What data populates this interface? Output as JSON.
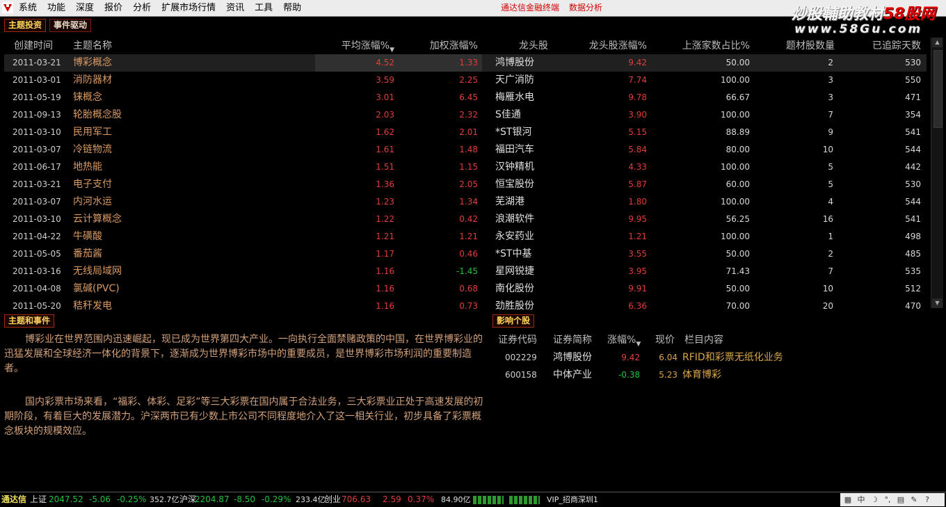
{
  "menu": {
    "items": [
      "系统",
      "功能",
      "深度",
      "报价",
      "分析",
      "扩展市场行情",
      "资讯",
      "工具",
      "帮助"
    ],
    "center_titles": [
      "通达信金融终端",
      "数据分析"
    ]
  },
  "watermark": {
    "line1_white": "炒股輔助教材",
    "line1_red": "58股网",
    "line2": "www.58Gu.com"
  },
  "tabs": {
    "theme_invest": "主题投资",
    "event_driven": "事件驱动"
  },
  "theme_table": {
    "headers": {
      "date": "创建时间",
      "name": "主题名称",
      "avg": "平均涨幅%",
      "weighted": "加权涨幅%",
      "leader": "龙头股",
      "leader_pct": "龙头股涨幅%",
      "rise_ratio": "上涨家数占比%",
      "count": "题材股数量",
      "days": "已追踪天数"
    },
    "rows": [
      {
        "date": "2011-03-21",
        "name": "博彩概念",
        "avg": "4.52",
        "weighted": "1.33",
        "leader": "鸿博股份",
        "leader_pct": "9.42",
        "rise": "50.00",
        "count": "2",
        "days": "530"
      },
      {
        "date": "2011-03-01",
        "name": "消防器材",
        "avg": "3.59",
        "weighted": "2.25",
        "leader": "天广消防",
        "leader_pct": "7.74",
        "rise": "100.00",
        "count": "3",
        "days": "550"
      },
      {
        "date": "2011-05-19",
        "name": "铼概念",
        "avg": "3.01",
        "weighted": "6.45",
        "leader": "梅雁水电",
        "leader_pct": "9.78",
        "rise": "66.67",
        "count": "3",
        "days": "471"
      },
      {
        "date": "2011-09-13",
        "name": "轮胎概念股",
        "avg": "2.03",
        "weighted": "2.32",
        "leader": "S佳通",
        "leader_pct": "3.90",
        "rise": "100.00",
        "count": "7",
        "days": "354"
      },
      {
        "date": "2011-03-10",
        "name": "民用军工",
        "avg": "1.62",
        "weighted": "2.01",
        "leader": "*ST银河",
        "leader_pct": "5.15",
        "rise": "88.89",
        "count": "9",
        "days": "541"
      },
      {
        "date": "2011-03-07",
        "name": "冷链物流",
        "avg": "1.61",
        "weighted": "1.48",
        "leader": "福田汽车",
        "leader_pct": "5.84",
        "rise": "80.00",
        "count": "10",
        "days": "544"
      },
      {
        "date": "2011-06-17",
        "name": "地热能",
        "avg": "1.51",
        "weighted": "1.15",
        "leader": "汉钟精机",
        "leader_pct": "4.33",
        "rise": "100.00",
        "count": "5",
        "days": "442"
      },
      {
        "date": "2011-03-21",
        "name": "电子支付",
        "avg": "1.36",
        "weighted": "2.05",
        "leader": "恒宝股份",
        "leader_pct": "5.87",
        "rise": "60.00",
        "count": "5",
        "days": "530"
      },
      {
        "date": "2011-03-07",
        "name": "内河水运",
        "avg": "1.23",
        "weighted": "1.34",
        "leader": "芜湖港",
        "leader_pct": "1.80",
        "rise": "100.00",
        "count": "4",
        "days": "544"
      },
      {
        "date": "2011-03-10",
        "name": "云计算概念",
        "avg": "1.22",
        "weighted": "0.42",
        "leader": "浪潮软件",
        "leader_pct": "9.95",
        "rise": "56.25",
        "count": "16",
        "days": "541"
      },
      {
        "date": "2011-04-22",
        "name": "牛磺酸",
        "avg": "1.21",
        "weighted": "1.21",
        "leader": "永安药业",
        "leader_pct": "1.21",
        "rise": "100.00",
        "count": "1",
        "days": "498"
      },
      {
        "date": "2011-05-05",
        "name": "番茄酱",
        "avg": "1.17",
        "weighted": "0.46",
        "leader": "*ST中基",
        "leader_pct": "3.55",
        "rise": "50.00",
        "count": "2",
        "days": "485"
      },
      {
        "date": "2011-03-16",
        "name": "无线局域网",
        "avg": "1.16",
        "weighted": "-1.45",
        "leader": "星网锐捷",
        "leader_pct": "3.95",
        "rise": "71.43",
        "count": "7",
        "days": "535"
      },
      {
        "date": "2011-04-08",
        "name": "氯碱(PVC)",
        "avg": "1.16",
        "weighted": "0.68",
        "leader": "南化股份",
        "leader_pct": "9.91",
        "rise": "50.00",
        "count": "10",
        "days": "512"
      },
      {
        "date": "2011-05-20",
        "name": "秸秆发电",
        "avg": "1.16",
        "weighted": "0.73",
        "leader": "劲胜股份",
        "leader_pct": "6.36",
        "rise": "70.00",
        "count": "20",
        "days": "470"
      }
    ]
  },
  "section_titles": {
    "theme_event": "主题和事件",
    "affected_stocks": "影响个股"
  },
  "description": {
    "paragraph1": "博彩业在世界范围内迅速崛起，现已成为世界第四大产业。一向执行全面禁赌政策的中国，在世界博彩业的迅猛发展和全球经济一体化的背景下，逐渐成为世界博彩市场中的重要成员，是世界博彩市场利润的重要制造者。",
    "paragraph2": "国内彩票市场来看，“福彩、体彩、足彩”等三大彩票在国内属于合法业务，三大彩票业正处于高速发展的初期阶段，有着巨大的发展潜力。沪深两市已有少数上市公司不同程度地介入了这一相关行业，初步具备了彩票概念板块的规模效应。"
  },
  "stock_table": {
    "headers": {
      "code": "证券代码",
      "name": "证券简称",
      "pct": "涨幅%",
      "price": "现价",
      "column": "栏目内容"
    },
    "rows": [
      {
        "code": "002229",
        "name": "鸿博股份",
        "pct": "9.42",
        "price": "6.04",
        "column": "RFID和彩票无纸化业务"
      },
      {
        "code": "600158",
        "name": "中体产业",
        "pct": "-0.38",
        "price": "5.23",
        "column": "体育博彩"
      }
    ]
  },
  "statusbar": {
    "brand": "通达信",
    "sh_label": "上证",
    "sh_index": "2047.52",
    "sh_change": "-5.06",
    "sh_pct": "-0.25%",
    "sh_amount": "352.7亿",
    "sz_label": "沪深",
    "sz_index": "2204.87",
    "sz_change": "-8.50",
    "sz_pct": "-0.29%",
    "sz_amount": "233.4亿",
    "cy_label": "创业",
    "cy_index": "706.63",
    "cy_change": "2.59",
    "cy_pct": "0.37%",
    "cy_amount": "84.90亿",
    "server": "VIP_招商深圳1"
  },
  "colors": {
    "up": "#e23c3c",
    "down": "#22c040",
    "theme_name": "#d99a64",
    "tab_border": "#a12810"
  }
}
